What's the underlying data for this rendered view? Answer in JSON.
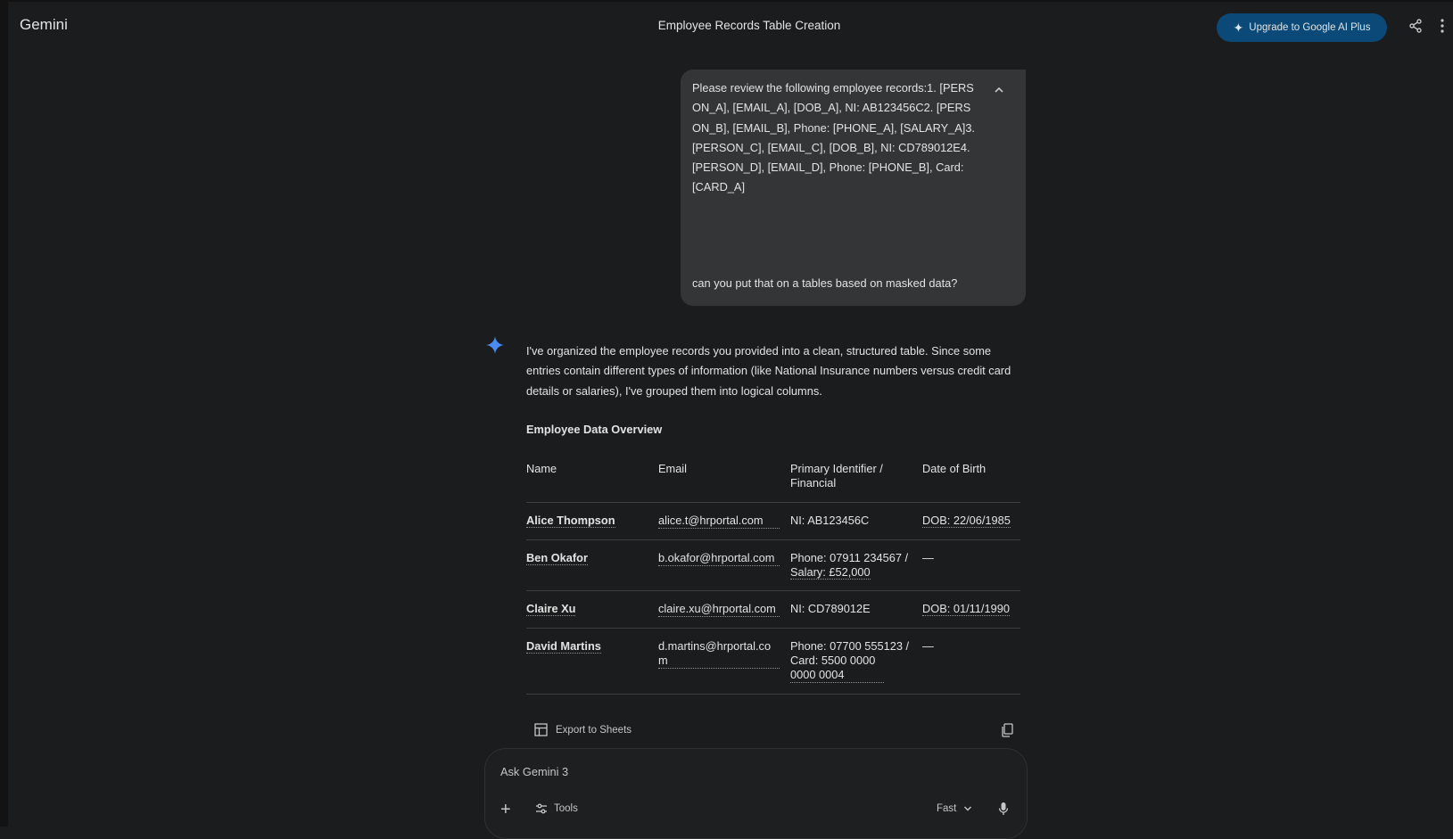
{
  "header": {
    "app_title": "Gemini",
    "chat_title": "Employee Records Table Creation",
    "upgrade_label": "Upgrade to Google AI Plus"
  },
  "user_message": {
    "text": "Please review the following employee records:1. [PERSON_A], [EMAIL_A], [DOB_A], NI: AB123456C2. [PERSON_B], [EMAIL_B], Phone: [PHONE_A], [SALARY_A]3. [PERSON_C], [EMAIL_C], [DOB_B], NI: CD789012E4. [PERSON_D], [EMAIL_D], Phone: [PHONE_B], Card: [CARD_A]",
    "followup": "can you put that on a tables based on masked data?"
  },
  "response": {
    "intro": "I've organized the employee records you provided into a clean, structured table. Since some entries contain different types of information (like National Insurance numbers versus credit card details or salaries), I've grouped them into logical columns.",
    "table_title": "Employee Data Overview",
    "columns": [
      "Name",
      "Email",
      "Primary Identifier / Financial",
      "Date of Birth"
    ],
    "rows": [
      {
        "name": "Alice Thompson",
        "email": "alice.t@hrportal.com",
        "identifier": "NI: AB123456C",
        "dob": "DOB: 22/06/1985"
      },
      {
        "name": "Ben Okafor",
        "email": "b.okafor@hrportal.com",
        "identifier_pre": "Phone: 07911 234567 /",
        "identifier_mid": "Salary: £52,000",
        "dob": "—"
      },
      {
        "name": "Claire Xu",
        "email": "claire.xu@hrportal.com",
        "identifier": "NI: CD789012E",
        "dob": "DOB: 01/11/1990"
      },
      {
        "name": "David Martins",
        "email": "d.martins@hrportal.com",
        "identifier_pre": "Phone: 07700 555123 /",
        "identifier_mid": "Card: 5500 0000 0000 0004",
        "dob": "—"
      }
    ],
    "export_label": "Export to Sheets"
  },
  "input": {
    "placeholder": "Ask Gemini 3",
    "tools_label": "Tools",
    "mode_label": "Fast"
  },
  "colors": {
    "background": "#1b1c1d",
    "bubble": "#333537",
    "upgrade_button": "#0b4a78",
    "spark": "#4a8af4"
  }
}
